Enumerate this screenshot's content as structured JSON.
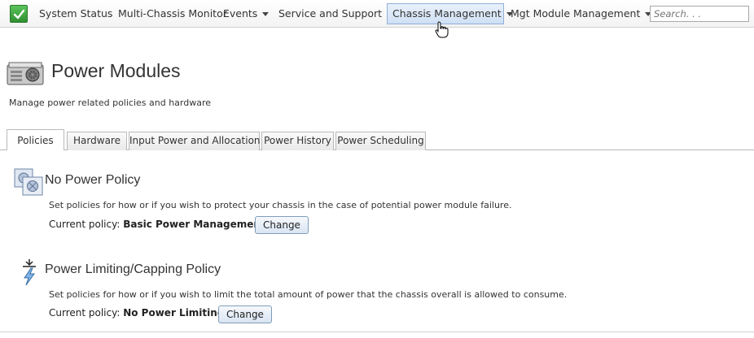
{
  "nav": {
    "items": [
      {
        "label": "System Status",
        "dropdown": false
      },
      {
        "label": "Multi-Chassis Monitor",
        "dropdown": false
      },
      {
        "label": "Events",
        "dropdown": true
      },
      {
        "label": "Service and Support",
        "dropdown": true
      },
      {
        "label": "Chassis Management",
        "dropdown": true,
        "active": true
      },
      {
        "label": "Mgt Module Management",
        "dropdown": true
      }
    ],
    "search_placeholder": "Search. . ."
  },
  "header": {
    "title": "Power Modules",
    "subtitle": "Manage power related policies and hardware"
  },
  "tabs": [
    {
      "label": "Policies",
      "active": true
    },
    {
      "label": "Hardware"
    },
    {
      "label": "Input Power and Allocation"
    },
    {
      "label": "Power History"
    },
    {
      "label": "Power Scheduling"
    }
  ],
  "policies": [
    {
      "title": "No Power Policy",
      "description": "Set policies for how or if you wish to protect your chassis in the case of potential power module failure.",
      "current_label": "Current policy:",
      "current_value": "Basic Power Management",
      "button_label": "Change"
    },
    {
      "title": "Power Limiting/Capping Policy",
      "description": "Set policies for how or if you wish to limit the total amount of power that the chassis overall is allowed to consume.",
      "current_label": "Current policy:",
      "current_value": "No Power Limiting",
      "button_label": "Change"
    }
  ],
  "colors": {
    "active_tab_bg": "#cfe0f5",
    "button_border": "#7f9db9",
    "check_green": "#3da63d"
  },
  "icons": {
    "status": "check-icon",
    "page": "power-supply-icon",
    "policy_1": "power-redundancy-icon",
    "policy_2": "power-capping-icon",
    "cursor": "hand-cursor-icon"
  }
}
